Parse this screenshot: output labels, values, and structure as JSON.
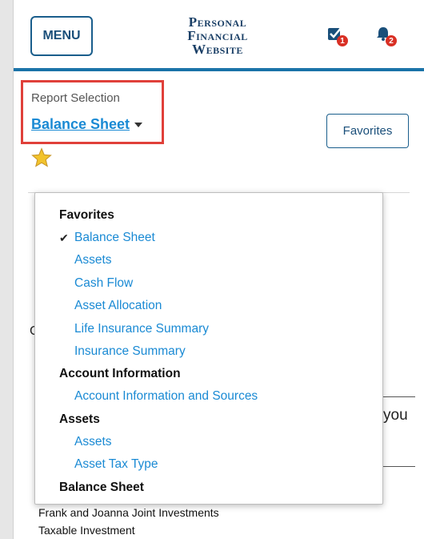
{
  "header": {
    "menu_label": "MENU",
    "brand_line1": "Personal",
    "brand_line2": "Financial",
    "brand_line3": "Website",
    "tasks_badge": "1",
    "alerts_badge": "2"
  },
  "report": {
    "label": "Report Selection",
    "selected": "Balance Sheet",
    "favorites_button": "Favorites"
  },
  "background_fragments": {
    "letter": "C",
    "partial_word": "you"
  },
  "dropdown": {
    "groups": [
      {
        "title": "Favorites",
        "items": [
          {
            "label": "Balance Sheet",
            "checked": true
          },
          {
            "label": "Assets"
          },
          {
            "label": "Cash Flow"
          },
          {
            "label": "Asset Allocation"
          },
          {
            "label": "Life Insurance Summary"
          },
          {
            "label": "Insurance Summary"
          }
        ]
      },
      {
        "title": "Account Information",
        "items": [
          {
            "label": "Account Information and Sources"
          }
        ]
      },
      {
        "title": "Assets",
        "items": [
          {
            "label": "Assets"
          },
          {
            "label": "Asset Tax Type"
          }
        ]
      },
      {
        "title": "Balance Sheet",
        "items": []
      }
    ]
  },
  "list_below": [
    "Frank and Joanna Joint Investments",
    "Taxable Investment"
  ],
  "colors": {
    "accent_blue": "#1a8ad4",
    "header_rule": "#1a73a8",
    "highlight_red": "#e0403a",
    "badge_red": "#d93025"
  }
}
